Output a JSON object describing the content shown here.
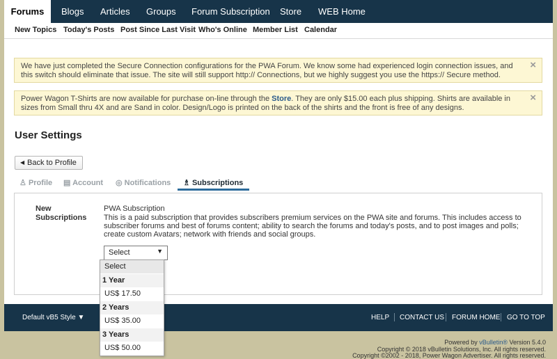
{
  "topnav": {
    "tabs": [
      "Forums",
      "Blogs",
      "Articles",
      "Groups",
      "Forum Subscription",
      "Store",
      "WEB Home"
    ]
  },
  "subnav": {
    "items": [
      "New Topics",
      "Today's Posts",
      "Post Since Last Visit",
      "Who's Online",
      "Member List",
      "Calendar"
    ]
  },
  "notices": [
    {
      "text": "We have just completed the Secure Connection configurations for the PWA Forum. We know some had experienced login connection issues, and this switch should eliminate that issue. The site will still support http:// Connections, but we highly suggest you use the https:// Secure method.",
      "close": "×"
    },
    {
      "text_before": "Power Wagon T-Shirts are now available for purchase on-line through the",
      "link": "Store",
      "text_after": ". They are only $15.00 each plus shipping. Shirts are available in sizes from Small thru 4X and are Sand in color. Design/Logo is printed on the back of the shirts and the front is free of any designs.",
      "close": "×"
    }
  ],
  "page_title": "User Settings",
  "back_button": {
    "arrow": "◀",
    "label": "Back to Profile"
  },
  "tabs": [
    {
      "icon": "♙",
      "label": "Profile"
    },
    {
      "icon": "▤",
      "label": "Account"
    },
    {
      "icon": "◎",
      "label": "Notifications"
    },
    {
      "icon": "♗",
      "label": "Subscriptions"
    }
  ],
  "subscriptions": {
    "section_label_1": "New",
    "section_label_2": "Subscriptions",
    "name": "PWA Subscription",
    "description": "This is a paid subscription that provides subscribers premium services on the PWA site and forums. This includes access to subscriber forums and best of forums content; ability to search the forums and today's posts, and to post images and polls; create custom Avatars; network with friends and social groups.",
    "select_value": "Select",
    "caret": "▼",
    "options": [
      {
        "label": "Select",
        "kind": "selected"
      },
      {
        "label": "1 Year",
        "kind": "group"
      },
      {
        "label": "US$ 17.50",
        "kind": "option"
      },
      {
        "label": "2 Years",
        "kind": "group"
      },
      {
        "label": "US$ 35.00",
        "kind": "option"
      },
      {
        "label": "3 Years",
        "kind": "group"
      },
      {
        "label": "US$ 50.00",
        "kind": "option"
      }
    ]
  },
  "footer": {
    "style": "Default vB5 Style ▼",
    "links": [
      "HELP",
      "CONTACT US",
      "FORUM HOME",
      "GO TO TOP"
    ]
  },
  "credits": {
    "powered_prefix": "Powered by",
    "powered_link": "vBulletin®",
    "powered_suffix": "Version 5.4.0",
    "copyright1": "Copyright © 2018 vBulletin Solutions, Inc. All rights reserved.",
    "copyright2": "Copyright ©2002 - 2018, Power Wagon Advertiser. All rights reserved."
  },
  "colors": {
    "nav_bg": "#173449",
    "accent": "#2c6b9b",
    "notice_bg": "#fdf7d4",
    "page_bg": "#c9c3a0"
  }
}
